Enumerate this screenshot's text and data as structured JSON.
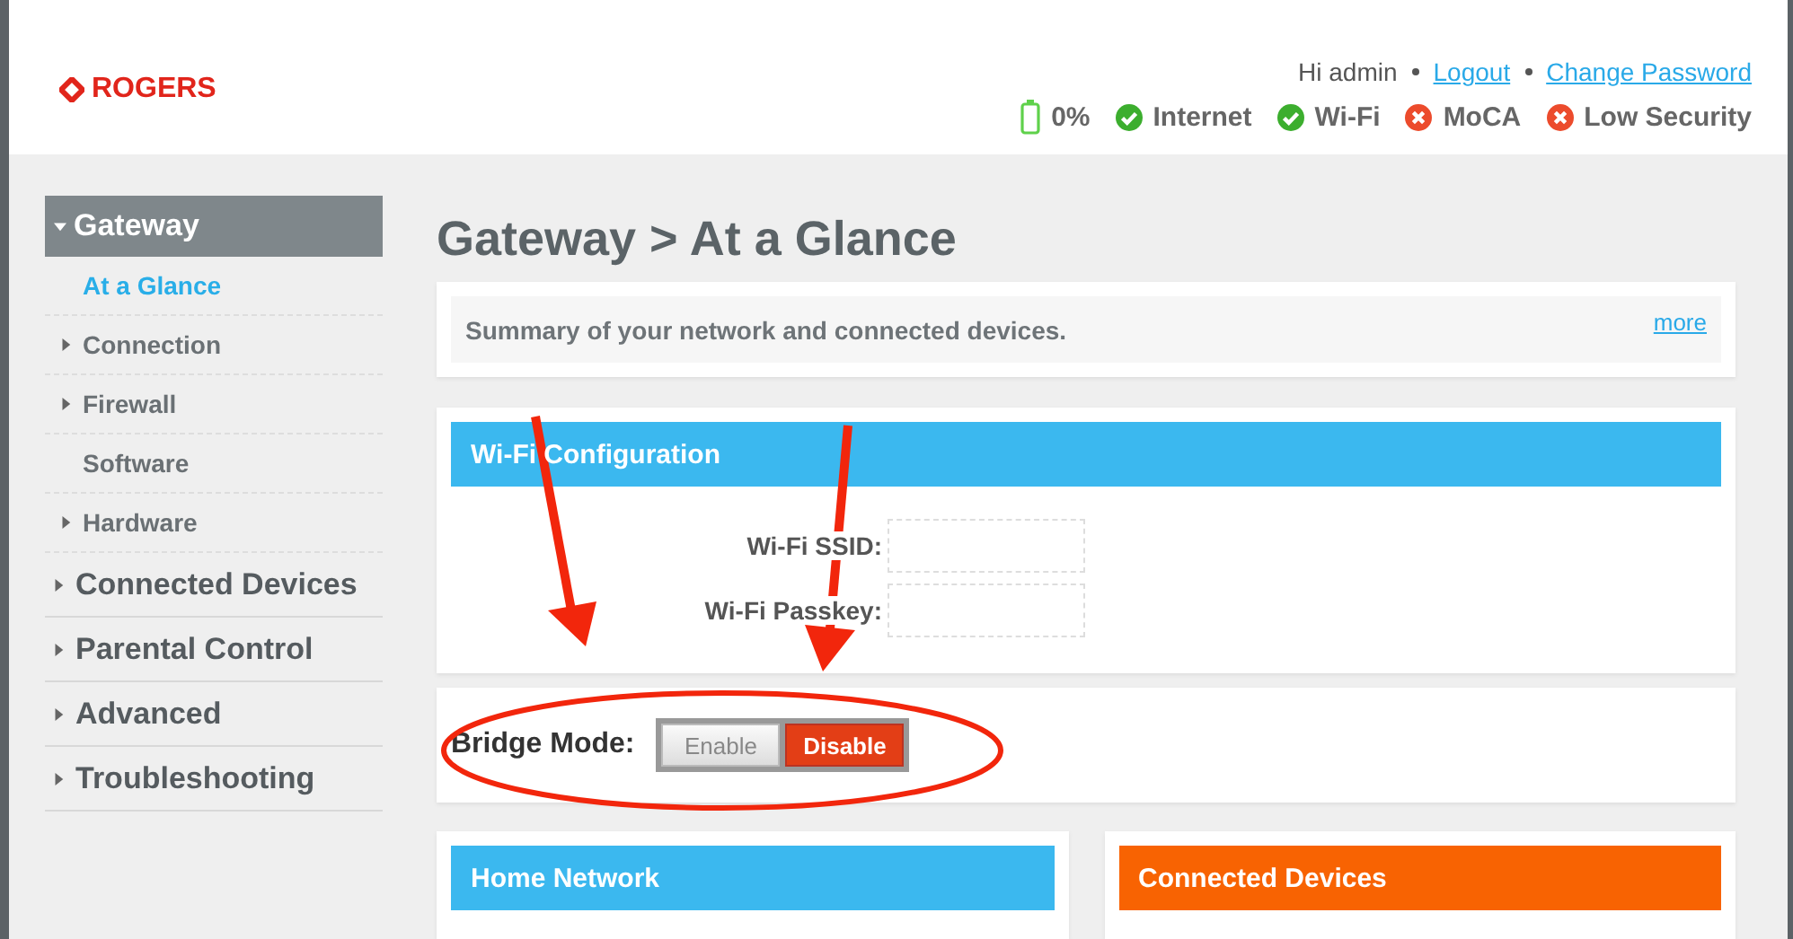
{
  "header": {
    "logo": "ROGERS",
    "greeting": "Hi admin",
    "links": [
      "Logout",
      "Change Password"
    ],
    "battery": "0%",
    "status": [
      {
        "label": "Internet",
        "kind": "ok"
      },
      {
        "label": "Wi-Fi",
        "kind": "ok"
      },
      {
        "label": "MoCA",
        "kind": "error"
      },
      {
        "label": "Low Security",
        "kind": "error"
      }
    ]
  },
  "sidebar": {
    "items": [
      {
        "label": "Gateway",
        "expanded": true,
        "children": [
          {
            "label": "At a Glance",
            "selected": true,
            "has_children": false
          },
          {
            "label": "Connection",
            "selected": false,
            "has_children": true
          },
          {
            "label": "Firewall",
            "selected": false,
            "has_children": true
          },
          {
            "label": "Software",
            "selected": false,
            "has_children": false
          },
          {
            "label": "Hardware",
            "selected": false,
            "has_children": true
          }
        ]
      },
      {
        "label": "Connected Devices",
        "expanded": false
      },
      {
        "label": "Parental Control",
        "expanded": false
      },
      {
        "label": "Advanced",
        "expanded": false
      },
      {
        "label": "Troubleshooting",
        "expanded": false
      }
    ]
  },
  "page": {
    "title": "Gateway > At a Glance",
    "summary": {
      "text": "Summary of your network and connected devices.",
      "link": "more"
    },
    "wifi_configuration": {
      "title": "Wi-Fi Configuration",
      "fields": [
        {
          "label": "Wi-Fi SSID:"
        },
        {
          "label": "Wi-Fi Passkey:"
        }
      ]
    },
    "bridge_mode": {
      "label": "Bridge Mode:",
      "options": [
        {
          "label": "Enable",
          "selected": false
        },
        {
          "label": "Disable",
          "selected": true
        }
      ]
    },
    "panels": [
      {
        "title": "Home Network",
        "color": "#3bb8ef"
      },
      {
        "title": "Connected Devices",
        "color": "#f86302"
      }
    ]
  }
}
